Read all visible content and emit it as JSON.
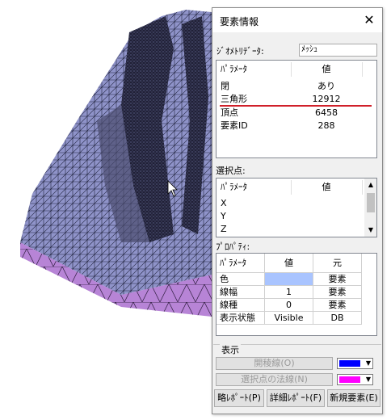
{
  "dialog": {
    "title": "要素情報",
    "close_glyph": "✕",
    "geometry_data_label": "ｼﾞｵﾒﾄﾘﾃﾞｰﾀ:",
    "geometry_data_value": "ﾒｯｼｭ",
    "info_table": {
      "col_param": "ﾊﾟﾗﾒｰﾀ",
      "col_value": "値",
      "rows": [
        {
          "param": "閉",
          "value": "あり"
        },
        {
          "param": "三角形",
          "value": "12912"
        },
        {
          "param": "頂点",
          "value": "6458"
        },
        {
          "param": "要素ID",
          "value": "288"
        }
      ]
    },
    "selected_point_label": "選択点:",
    "selected_point_table": {
      "col_param": "ﾊﾟﾗﾒｰﾀ",
      "col_value": "値",
      "rows": [
        {
          "param": "X"
        },
        {
          "param": "Y"
        },
        {
          "param": "Z"
        }
      ]
    },
    "property_label": "ﾌﾟﾛﾊﾟﾃｨ:",
    "property_table": {
      "col_param": "ﾊﾟﾗﾒｰﾀ",
      "col_value": "値",
      "col_origin": "元",
      "rows": [
        {
          "param": "色",
          "value": "",
          "origin": "要素"
        },
        {
          "param": "線幅",
          "value": "1",
          "origin": "要素"
        },
        {
          "param": "線種",
          "value": "0",
          "origin": "要素"
        },
        {
          "param": "表示状態",
          "value": "Visible",
          "origin": "DB"
        }
      ]
    },
    "display_group_label": "表示",
    "outline_button": "開稜線(O)",
    "normal_button": "選択点の法線(N)",
    "report_short": "略ﾚﾎﾟｰﾄ(P)",
    "report_detail": "詳細ﾚﾎﾟｰﾄ(F)",
    "new_element": "新規要素(E)"
  },
  "colors": {
    "mesh_face": "#8f93c9",
    "mesh_side": "#b784d6",
    "wire": "#1a1a2e",
    "property_color_swatch": "#a9c4ff",
    "outline_color": "#0000ff",
    "normal_color": "#ff00ff",
    "highlight_line": "#d0202a"
  }
}
